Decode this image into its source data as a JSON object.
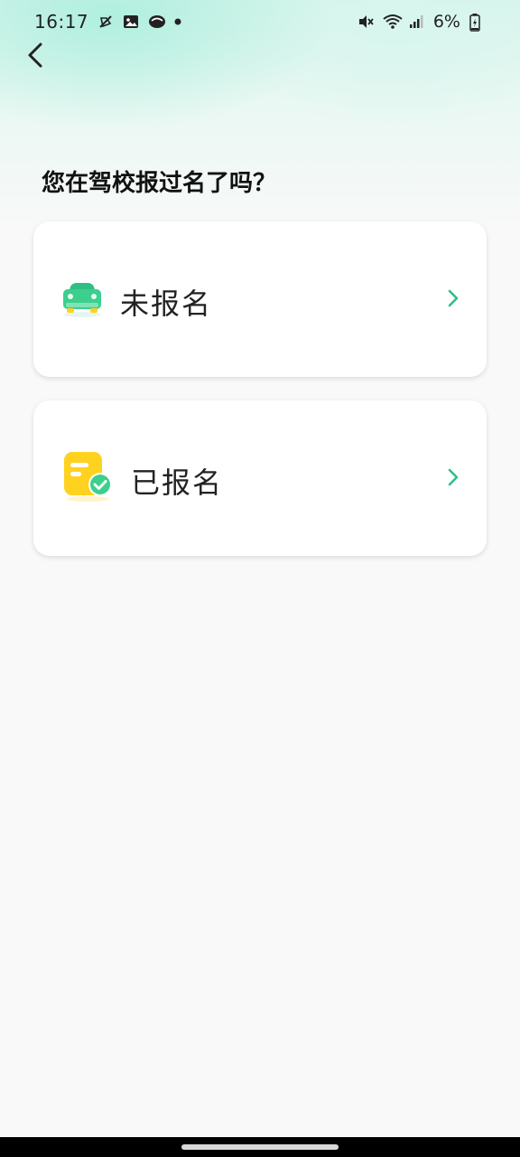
{
  "status_bar": {
    "time": "16:17",
    "battery": "6%",
    "left_icons": [
      "no-cast-icon",
      "image-icon",
      "weather-icon",
      "dot-icon"
    ],
    "right_icons": [
      "mute-icon",
      "wifi-icon",
      "signal-icon",
      "battery-charging-icon"
    ]
  },
  "nav": {
    "back_icon": "back-chevron-icon"
  },
  "page": {
    "question": "您在驾校报过名了吗？"
  },
  "options": [
    {
      "label": "未报名",
      "icon": "car-icon",
      "accent": "#3ccf8e"
    },
    {
      "label": "已报名",
      "icon": "registered-check-icon",
      "accent": "#ffd21f"
    }
  ],
  "colors": {
    "accent_green": "#3ccf8e",
    "accent_yellow": "#ffd21f",
    "chevron": "#2fbf85"
  }
}
